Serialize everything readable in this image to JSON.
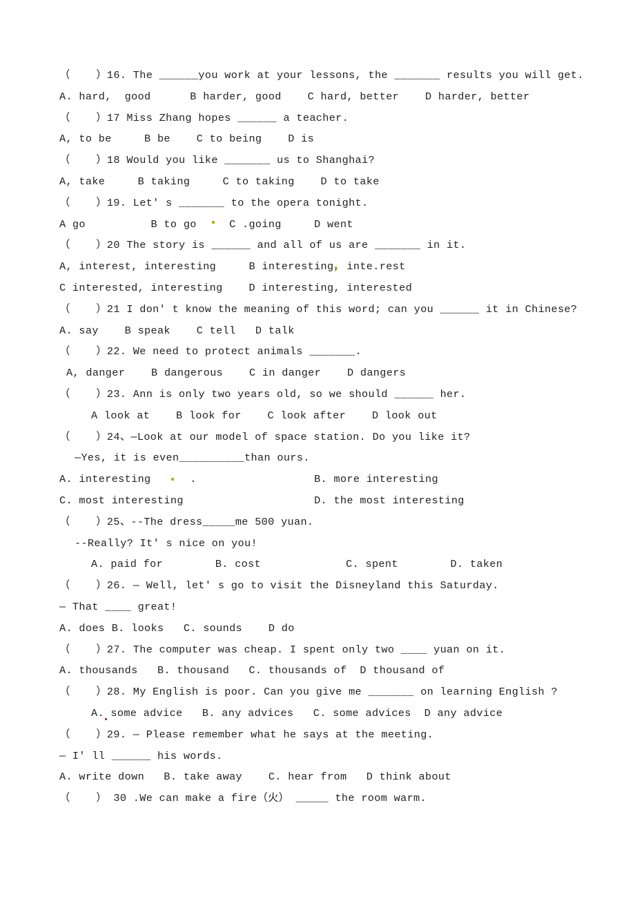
{
  "document": {
    "type": "english-exam-worksheet",
    "language": "English with Chinese annotations",
    "background_color": "#ffffff",
    "text_color": "#222222",
    "artifact_color": "#b3b300"
  },
  "lines": [
    {
      "id": "q16-stem",
      "indent": 0,
      "text": "（    ）16. The ______you work at your lessons, the _______ results you will get."
    },
    {
      "id": "q16-options",
      "indent": 0,
      "text": "A. hard,  good      B harder, good    C hard, better    D harder, better"
    },
    {
      "id": "q17-stem",
      "indent": 0,
      "text": "（    ）17 Miss Zhang hopes ______ a teacher."
    },
    {
      "id": "q17-options",
      "indent": 0,
      "text": "A, to be     B be    C to being    D is"
    },
    {
      "id": "q18-stem",
      "indent": 0,
      "text": "（    ）18 Would you like _______ us to Shanghai?"
    },
    {
      "id": "q18-options",
      "indent": 0,
      "text": "A, take     B taking     C to taking    D to take"
    },
    {
      "id": "q19-stem",
      "indent": 0,
      "text": "（    ）19. Let' s _______ to the opera tonight."
    },
    {
      "id": "q19-options",
      "indent": 0,
      "text": "A go          B to go     C .going     D went",
      "speck_after": "C "
    },
    {
      "id": "q20-stem",
      "indent": 0,
      "text": "（    ）20 The story is ______ and all of us are _______ in it."
    },
    {
      "id": "q20-options-ab",
      "indent": 0,
      "text": "A, interest, interesting     B interesting, inte.rest"
    },
    {
      "id": "q20-options-cd",
      "indent": 0,
      "text": "C interested, interesting    D interesting, interested"
    },
    {
      "id": "q21-stem",
      "indent": 0,
      "text": "（    ）21 I don' t know the meaning of this word; can you ______ it in Chinese?"
    },
    {
      "id": "q21-options",
      "indent": 0,
      "text": "A. say    B speak    C tell   D talk"
    },
    {
      "id": "q22-stem",
      "indent": 0,
      "text": "（    ）22. We need to protect animals _______."
    },
    {
      "id": "q22-options",
      "indent": 1,
      "text": "A, danger    B dangerous    C in danger    D dangers"
    },
    {
      "id": "q23-stem",
      "indent": 0,
      "text": "（    ）23. Ann is only two years old, so we should ______ her."
    },
    {
      "id": "q23-options",
      "indent": 3,
      "text": "A look at    B look for    C look after    D look out"
    },
    {
      "id": "q24-stem",
      "indent": 0,
      "text": "（    ）24、—Look at our model of space station. Do you like it?"
    },
    {
      "id": "q24-reply",
      "indent": 2,
      "text": "—Yes, it is even__________than ours."
    },
    {
      "id": "q24-options-ab",
      "indent": 0,
      "text": "A. interesting      .                  B. more interesting",
      "speck_mid": true
    },
    {
      "id": "q24-options-cd",
      "indent": 0,
      "text": "C. most interesting                    D. the most interesting"
    },
    {
      "id": "q25-stem",
      "indent": 0,
      "text": "（    ）25、--The dress_____me 500 yuan."
    },
    {
      "id": "q25-reply",
      "indent": 2,
      "text": "--Really? It' s nice on you!"
    },
    {
      "id": "q25-options",
      "indent": 3,
      "text": "A. paid for        B. cost             C. spent        D. taken"
    },
    {
      "id": "q26-stem",
      "indent": 0,
      "text": "（    ）26. — Well, let' s go to visit the Disneyland this Saturday."
    },
    {
      "id": "q26-reply",
      "indent": 0,
      "text": "— That ____ great!"
    },
    {
      "id": "q26-options",
      "indent": 0,
      "text": "A. does B. looks   C. sounds    D do"
    },
    {
      "id": "q27-stem",
      "indent": 0,
      "text": "（    ）27. The computer was cheap. I spent only two ____ yuan on it."
    },
    {
      "id": "q27-options",
      "indent": 0,
      "text": "A. thousands   B. thousand   C. thousands of  D thousand of"
    },
    {
      "id": "q28-stem",
      "indent": 0,
      "text": "（    ）28. My English is poor. Can you give me _______ on learning English ?"
    },
    {
      "id": "q28-options",
      "indent": 3,
      "text": "A. some advice   B. any advices   C. some advices  D any advice"
    },
    {
      "id": "q29-stem",
      "indent": 0,
      "text": "（    ）29. — Please remember what he says at the meeting."
    },
    {
      "id": "q29-reply",
      "indent": 0,
      "text": "— I' ll ______ his words."
    },
    {
      "id": "q29-options",
      "indent": 0,
      "text": "A. write down   B. take away    C. hear from   D think about"
    },
    {
      "id": "q30-stem",
      "indent": 0,
      "text": "（    ） 30 .We can make a fire（火） _____ the room warm."
    }
  ]
}
